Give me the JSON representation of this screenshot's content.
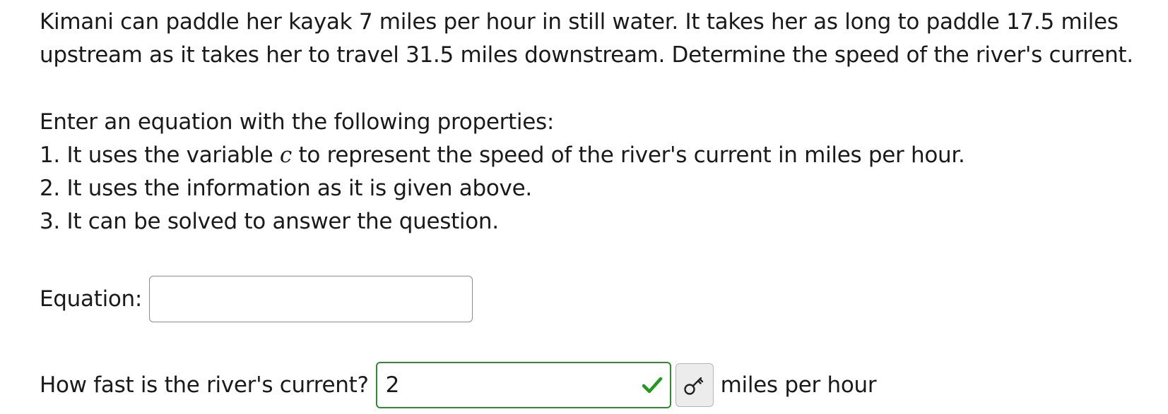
{
  "problem": {
    "statement": "Kimani can paddle her kayak 7 miles per hour in still water. It takes her as long to paddle 17.5 miles upstream as it takes her to travel 31.5 miles downstream. Determine the speed of the river's current.",
    "instructions_heading": "Enter an equation with the following properties:",
    "property_1_before": "1. It uses the variable ",
    "property_1_var": "c",
    "property_1_after": " to represent the speed of the river's current in miles per hour.",
    "property_2": "2. It uses the information as it is given above.",
    "property_3": "3. It can be solved to answer the question."
  },
  "equation": {
    "label": "Equation:",
    "value": ""
  },
  "answer": {
    "question": "How fast is the river's current?",
    "value": "2",
    "units": "miles per hour",
    "status": "correct"
  },
  "colors": {
    "correct_green": "#2e8b2e",
    "check_green": "#1f9a1f"
  },
  "icons": {
    "status": "check-icon",
    "answer_key": "key-icon"
  }
}
